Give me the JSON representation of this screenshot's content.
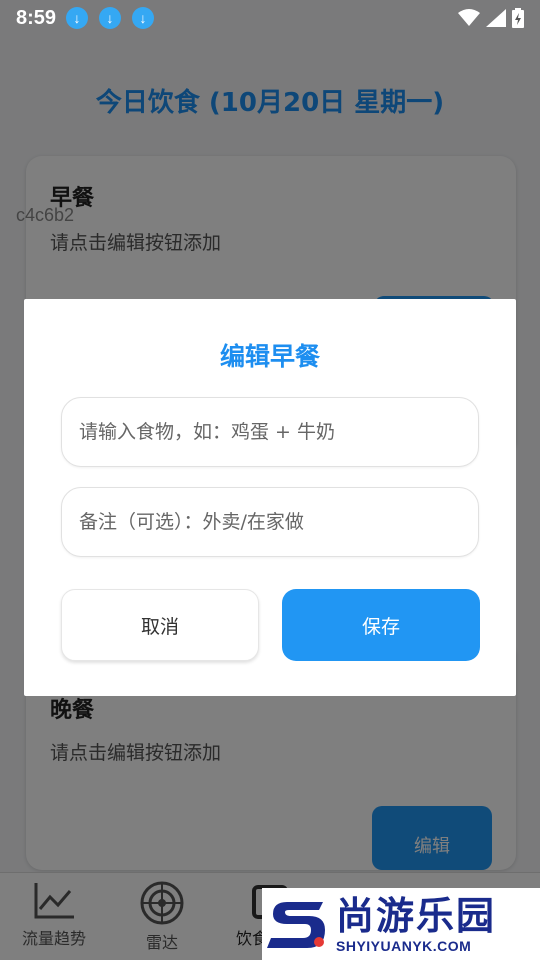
{
  "status_bar": {
    "time": "8:59"
  },
  "page": {
    "title": "今日饮食 (10月20日 星期一)",
    "overlay_text": "c4c6b2",
    "cards": [
      {
        "title": "早餐",
        "description": "请点击编辑按钮添加"
      },
      {
        "title": "晚餐",
        "description": "请点击编辑按钮添加",
        "edit_label": "编辑"
      }
    ]
  },
  "bottom_nav": {
    "items": [
      {
        "label": "流量趋势",
        "icon": "chart-line-icon"
      },
      {
        "label": "雷达",
        "icon": "radar-icon"
      },
      {
        "label": "饮食",
        "icon": "food-icon"
      }
    ]
  },
  "dialog": {
    "title": "编辑早餐",
    "food_input": {
      "placeholder": "请输入食物，如：鸡蛋 + 牛奶",
      "value": ""
    },
    "note_input": {
      "placeholder": "备注（可选）：外卖/在家做",
      "value": ""
    },
    "cancel_label": "取消",
    "save_label": "保存"
  },
  "brand": {
    "name": "尚游乐园",
    "url": "SHYIYUANYK.COM"
  },
  "colors": {
    "accent": "#2196f3",
    "title_blue": "#1d8ef0",
    "brand_navy": "#1a2b8c"
  }
}
